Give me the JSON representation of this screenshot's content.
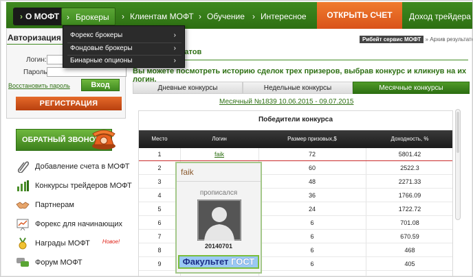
{
  "nav": {
    "brand": "О МОФТ",
    "items": [
      "Брокеры",
      "Клиентам МОФТ",
      "Обучение",
      "Интересное"
    ],
    "cta": "ОТКРЫТЬ СЧЕТ",
    "right": "Доход трейдера"
  },
  "dropdown": {
    "items": [
      "Форекс брокеры",
      "Фондовые брокеры",
      "Бинарные опционы"
    ]
  },
  "auth": {
    "title": "Авторизация",
    "login_label": "Логин:",
    "password_label": "Пароль:",
    "restore": "Восстановить пароль",
    "enter": "Вход",
    "register": "РЕГИСТРАЦИЯ"
  },
  "callback": "ОБРАТНЫЙ ЗВОНОК",
  "sidebar": {
    "items": [
      {
        "label": "Добавление счета в МОФТ",
        "icon": "paperclip-icon"
      },
      {
        "label": "Конкурсы трейдеров МОФТ",
        "icon": "bar-chart-icon"
      },
      {
        "label": "Партнерам",
        "icon": "handshake-icon"
      },
      {
        "label": "Форекс для начинающих",
        "icon": "chart-board-icon"
      },
      {
        "label": "Награды МОФТ",
        "icon": "medal-icon",
        "badge": "Новое!"
      },
      {
        "label": "Форум МОФТ",
        "icon": "chat-bubbles-icon"
      }
    ]
  },
  "breadcrumb": {
    "link": "Рибейт сервис МОФТ",
    "rest": "» Архив результатов"
  },
  "main": {
    "title_fragment": "татов",
    "intro": "Вы можете посмотреть историю сделок трех призеров, выбрав конкурс и кликнув на их логин.",
    "tabs": [
      "Дневные конкурсы",
      "Недельные конкурсы",
      "Месячные конкурсы"
    ],
    "contest_link": "Месячный №1839 10.06.2015 - 09.07.2015",
    "table_title": "Победители конкурса",
    "columns": [
      "Место",
      "Логин",
      "Размер призовых,$",
      "Доходность, %"
    ],
    "rows": [
      {
        "place": "1",
        "login": "faik",
        "prize": "72",
        "profit": "5801.42"
      },
      {
        "place": "2",
        "login": "",
        "prize": "60",
        "profit": "2522.3"
      },
      {
        "place": "3",
        "login": "",
        "prize": "48",
        "profit": "2271.33"
      },
      {
        "place": "4",
        "login": "",
        "prize": "36",
        "profit": "1766.09"
      },
      {
        "place": "5",
        "login": "",
        "prize": "24",
        "profit": "1722.72"
      },
      {
        "place": "6",
        "login": "",
        "prize": "6",
        "profit": "701.08"
      },
      {
        "place": "7",
        "login": "",
        "prize": "6",
        "profit": "670.59"
      },
      {
        "place": "8",
        "login": "",
        "prize": "6",
        "profit": "468"
      },
      {
        "place": "9",
        "login": "",
        "prize": "6",
        "profit": "405"
      }
    ]
  },
  "popup": {
    "name": "faik",
    "registered": "прописался",
    "date": "20140701",
    "badge_main": "Факультет",
    "badge_accent": "ГОСТ"
  },
  "colors": {
    "brand_green": "#2d6f12",
    "cta_orange": "#d9531a",
    "header_dark": "#1b1b1b"
  }
}
